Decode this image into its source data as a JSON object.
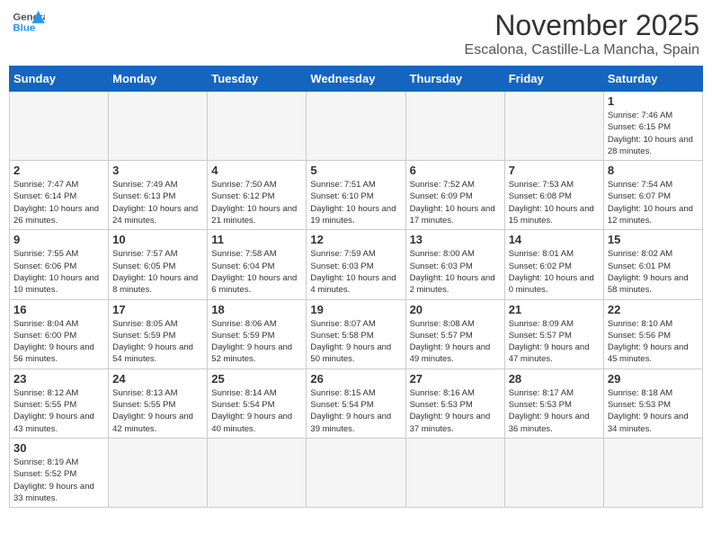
{
  "header": {
    "logo_general": "General",
    "logo_blue": "Blue",
    "month_title": "November 2025",
    "location": "Escalona, Castille-La Mancha, Spain"
  },
  "days_of_week": [
    "Sunday",
    "Monday",
    "Tuesday",
    "Wednesday",
    "Thursday",
    "Friday",
    "Saturday"
  ],
  "weeks": [
    [
      {
        "day": "",
        "info": ""
      },
      {
        "day": "",
        "info": ""
      },
      {
        "day": "",
        "info": ""
      },
      {
        "day": "",
        "info": ""
      },
      {
        "day": "",
        "info": ""
      },
      {
        "day": "",
        "info": ""
      },
      {
        "day": "1",
        "info": "Sunrise: 7:46 AM\nSunset: 6:15 PM\nDaylight: 10 hours and 28 minutes."
      }
    ],
    [
      {
        "day": "2",
        "info": "Sunrise: 7:47 AM\nSunset: 6:14 PM\nDaylight: 10 hours and 26 minutes."
      },
      {
        "day": "3",
        "info": "Sunrise: 7:49 AM\nSunset: 6:13 PM\nDaylight: 10 hours and 24 minutes."
      },
      {
        "day": "4",
        "info": "Sunrise: 7:50 AM\nSunset: 6:12 PM\nDaylight: 10 hours and 21 minutes."
      },
      {
        "day": "5",
        "info": "Sunrise: 7:51 AM\nSunset: 6:10 PM\nDaylight: 10 hours and 19 minutes."
      },
      {
        "day": "6",
        "info": "Sunrise: 7:52 AM\nSunset: 6:09 PM\nDaylight: 10 hours and 17 minutes."
      },
      {
        "day": "7",
        "info": "Sunrise: 7:53 AM\nSunset: 6:08 PM\nDaylight: 10 hours and 15 minutes."
      },
      {
        "day": "8",
        "info": "Sunrise: 7:54 AM\nSunset: 6:07 PM\nDaylight: 10 hours and 12 minutes."
      }
    ],
    [
      {
        "day": "9",
        "info": "Sunrise: 7:55 AM\nSunset: 6:06 PM\nDaylight: 10 hours and 10 minutes."
      },
      {
        "day": "10",
        "info": "Sunrise: 7:57 AM\nSunset: 6:05 PM\nDaylight: 10 hours and 8 minutes."
      },
      {
        "day": "11",
        "info": "Sunrise: 7:58 AM\nSunset: 6:04 PM\nDaylight: 10 hours and 6 minutes."
      },
      {
        "day": "12",
        "info": "Sunrise: 7:59 AM\nSunset: 6:03 PM\nDaylight: 10 hours and 4 minutes."
      },
      {
        "day": "13",
        "info": "Sunrise: 8:00 AM\nSunset: 6:03 PM\nDaylight: 10 hours and 2 minutes."
      },
      {
        "day": "14",
        "info": "Sunrise: 8:01 AM\nSunset: 6:02 PM\nDaylight: 10 hours and 0 minutes."
      },
      {
        "day": "15",
        "info": "Sunrise: 8:02 AM\nSunset: 6:01 PM\nDaylight: 9 hours and 58 minutes."
      }
    ],
    [
      {
        "day": "16",
        "info": "Sunrise: 8:04 AM\nSunset: 6:00 PM\nDaylight: 9 hours and 56 minutes."
      },
      {
        "day": "17",
        "info": "Sunrise: 8:05 AM\nSunset: 5:59 PM\nDaylight: 9 hours and 54 minutes."
      },
      {
        "day": "18",
        "info": "Sunrise: 8:06 AM\nSunset: 5:59 PM\nDaylight: 9 hours and 52 minutes."
      },
      {
        "day": "19",
        "info": "Sunrise: 8:07 AM\nSunset: 5:58 PM\nDaylight: 9 hours and 50 minutes."
      },
      {
        "day": "20",
        "info": "Sunrise: 8:08 AM\nSunset: 5:57 PM\nDaylight: 9 hours and 49 minutes."
      },
      {
        "day": "21",
        "info": "Sunrise: 8:09 AM\nSunset: 5:57 PM\nDaylight: 9 hours and 47 minutes."
      },
      {
        "day": "22",
        "info": "Sunrise: 8:10 AM\nSunset: 5:56 PM\nDaylight: 9 hours and 45 minutes."
      }
    ],
    [
      {
        "day": "23",
        "info": "Sunrise: 8:12 AM\nSunset: 5:55 PM\nDaylight: 9 hours and 43 minutes."
      },
      {
        "day": "24",
        "info": "Sunrise: 8:13 AM\nSunset: 5:55 PM\nDaylight: 9 hours and 42 minutes."
      },
      {
        "day": "25",
        "info": "Sunrise: 8:14 AM\nSunset: 5:54 PM\nDaylight: 9 hours and 40 minutes."
      },
      {
        "day": "26",
        "info": "Sunrise: 8:15 AM\nSunset: 5:54 PM\nDaylight: 9 hours and 39 minutes."
      },
      {
        "day": "27",
        "info": "Sunrise: 8:16 AM\nSunset: 5:53 PM\nDaylight: 9 hours and 37 minutes."
      },
      {
        "day": "28",
        "info": "Sunrise: 8:17 AM\nSunset: 5:53 PM\nDaylight: 9 hours and 36 minutes."
      },
      {
        "day": "29",
        "info": "Sunrise: 8:18 AM\nSunset: 5:53 PM\nDaylight: 9 hours and 34 minutes."
      }
    ],
    [
      {
        "day": "30",
        "info": "Sunrise: 8:19 AM\nSunset: 5:52 PM\nDaylight: 9 hours and 33 minutes."
      },
      {
        "day": "",
        "info": ""
      },
      {
        "day": "",
        "info": ""
      },
      {
        "day": "",
        "info": ""
      },
      {
        "day": "",
        "info": ""
      },
      {
        "day": "",
        "info": ""
      },
      {
        "day": "",
        "info": ""
      }
    ]
  ]
}
